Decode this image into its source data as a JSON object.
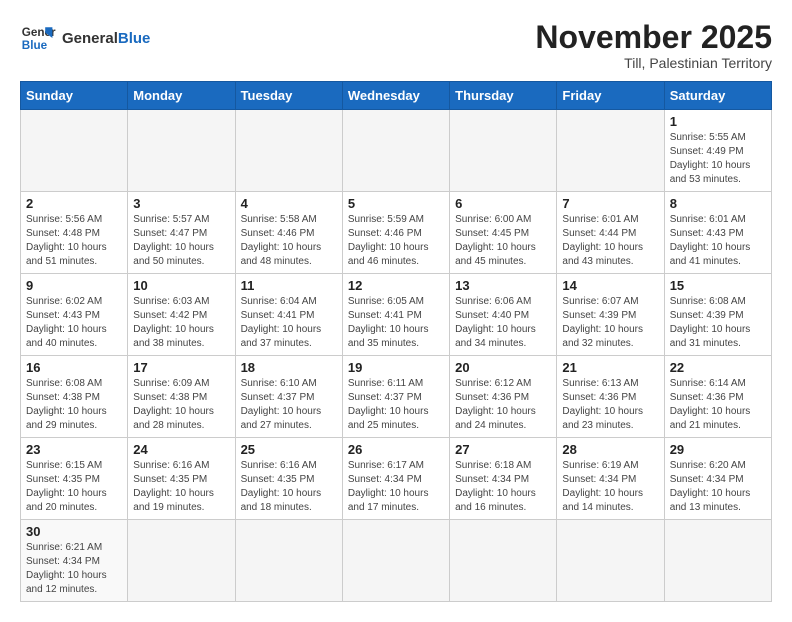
{
  "logo": {
    "text_general": "General",
    "text_blue": "Blue"
  },
  "title": {
    "month_year": "November 2025",
    "location": "Till, Palestinian Territory"
  },
  "headers": [
    "Sunday",
    "Monday",
    "Tuesday",
    "Wednesday",
    "Thursday",
    "Friday",
    "Saturday"
  ],
  "weeks": [
    [
      {
        "day": "",
        "info": ""
      },
      {
        "day": "",
        "info": ""
      },
      {
        "day": "",
        "info": ""
      },
      {
        "day": "",
        "info": ""
      },
      {
        "day": "",
        "info": ""
      },
      {
        "day": "",
        "info": ""
      },
      {
        "day": "1",
        "info": "Sunrise: 5:55 AM\nSunset: 4:49 PM\nDaylight: 10 hours and 53 minutes."
      }
    ],
    [
      {
        "day": "2",
        "info": "Sunrise: 5:56 AM\nSunset: 4:48 PM\nDaylight: 10 hours and 51 minutes."
      },
      {
        "day": "3",
        "info": "Sunrise: 5:57 AM\nSunset: 4:47 PM\nDaylight: 10 hours and 50 minutes."
      },
      {
        "day": "4",
        "info": "Sunrise: 5:58 AM\nSunset: 4:46 PM\nDaylight: 10 hours and 48 minutes."
      },
      {
        "day": "5",
        "info": "Sunrise: 5:59 AM\nSunset: 4:46 PM\nDaylight: 10 hours and 46 minutes."
      },
      {
        "day": "6",
        "info": "Sunrise: 6:00 AM\nSunset: 4:45 PM\nDaylight: 10 hours and 45 minutes."
      },
      {
        "day": "7",
        "info": "Sunrise: 6:01 AM\nSunset: 4:44 PM\nDaylight: 10 hours and 43 minutes."
      },
      {
        "day": "8",
        "info": "Sunrise: 6:01 AM\nSunset: 4:43 PM\nDaylight: 10 hours and 41 minutes."
      }
    ],
    [
      {
        "day": "9",
        "info": "Sunrise: 6:02 AM\nSunset: 4:43 PM\nDaylight: 10 hours and 40 minutes."
      },
      {
        "day": "10",
        "info": "Sunrise: 6:03 AM\nSunset: 4:42 PM\nDaylight: 10 hours and 38 minutes."
      },
      {
        "day": "11",
        "info": "Sunrise: 6:04 AM\nSunset: 4:41 PM\nDaylight: 10 hours and 37 minutes."
      },
      {
        "day": "12",
        "info": "Sunrise: 6:05 AM\nSunset: 4:41 PM\nDaylight: 10 hours and 35 minutes."
      },
      {
        "day": "13",
        "info": "Sunrise: 6:06 AM\nSunset: 4:40 PM\nDaylight: 10 hours and 34 minutes."
      },
      {
        "day": "14",
        "info": "Sunrise: 6:07 AM\nSunset: 4:39 PM\nDaylight: 10 hours and 32 minutes."
      },
      {
        "day": "15",
        "info": "Sunrise: 6:08 AM\nSunset: 4:39 PM\nDaylight: 10 hours and 31 minutes."
      }
    ],
    [
      {
        "day": "16",
        "info": "Sunrise: 6:08 AM\nSunset: 4:38 PM\nDaylight: 10 hours and 29 minutes."
      },
      {
        "day": "17",
        "info": "Sunrise: 6:09 AM\nSunset: 4:38 PM\nDaylight: 10 hours and 28 minutes."
      },
      {
        "day": "18",
        "info": "Sunrise: 6:10 AM\nSunset: 4:37 PM\nDaylight: 10 hours and 27 minutes."
      },
      {
        "day": "19",
        "info": "Sunrise: 6:11 AM\nSunset: 4:37 PM\nDaylight: 10 hours and 25 minutes."
      },
      {
        "day": "20",
        "info": "Sunrise: 6:12 AM\nSunset: 4:36 PM\nDaylight: 10 hours and 24 minutes."
      },
      {
        "day": "21",
        "info": "Sunrise: 6:13 AM\nSunset: 4:36 PM\nDaylight: 10 hours and 23 minutes."
      },
      {
        "day": "22",
        "info": "Sunrise: 6:14 AM\nSunset: 4:36 PM\nDaylight: 10 hours and 21 minutes."
      }
    ],
    [
      {
        "day": "23",
        "info": "Sunrise: 6:15 AM\nSunset: 4:35 PM\nDaylight: 10 hours and 20 minutes."
      },
      {
        "day": "24",
        "info": "Sunrise: 6:16 AM\nSunset: 4:35 PM\nDaylight: 10 hours and 19 minutes."
      },
      {
        "day": "25",
        "info": "Sunrise: 6:16 AM\nSunset: 4:35 PM\nDaylight: 10 hours and 18 minutes."
      },
      {
        "day": "26",
        "info": "Sunrise: 6:17 AM\nSunset: 4:34 PM\nDaylight: 10 hours and 17 minutes."
      },
      {
        "day": "27",
        "info": "Sunrise: 6:18 AM\nSunset: 4:34 PM\nDaylight: 10 hours and 16 minutes."
      },
      {
        "day": "28",
        "info": "Sunrise: 6:19 AM\nSunset: 4:34 PM\nDaylight: 10 hours and 14 minutes."
      },
      {
        "day": "29",
        "info": "Sunrise: 6:20 AM\nSunset: 4:34 PM\nDaylight: 10 hours and 13 minutes."
      }
    ],
    [
      {
        "day": "30",
        "info": "Sunrise: 6:21 AM\nSunset: 4:34 PM\nDaylight: 10 hours and 12 minutes."
      },
      {
        "day": "",
        "info": ""
      },
      {
        "day": "",
        "info": ""
      },
      {
        "day": "",
        "info": ""
      },
      {
        "day": "",
        "info": ""
      },
      {
        "day": "",
        "info": ""
      },
      {
        "day": "",
        "info": ""
      }
    ]
  ]
}
